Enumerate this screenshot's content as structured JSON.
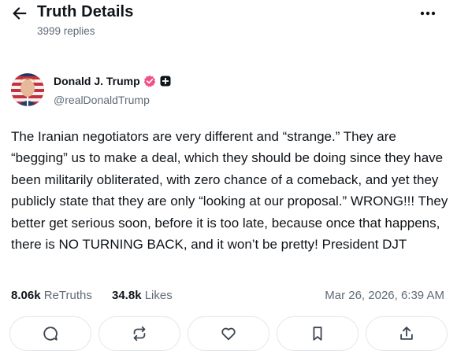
{
  "header": {
    "title": "Truth Details",
    "replies": "3999 replies",
    "back_icon": "arrow-left-icon",
    "more_icon": "more-horizontal-icon"
  },
  "author": {
    "name": "Donald J. Trump",
    "handle": "@realDonaldTrump",
    "verified_icon": "verified-badge-icon",
    "verified_color": "#f0508a",
    "plus_icon": "plus-badge-icon"
  },
  "post": {
    "text": "The Iranian negotiators are very different and “strange.” They are “begging” us to make a deal, which they should be doing since they have been militarily obliterated, with zero chance of a comeback, and yet they publicly state that they are only “looking at our proposal.” WRONG!!! They better get serious soon, before it is too late, because once that happens, there is NO TURNING BACK, and it won’t be pretty! President DJT"
  },
  "stats": {
    "retruths_count": "8.06k",
    "retruths_label": "ReTruths",
    "likes_count": "34.8k",
    "likes_label": "Likes",
    "timestamp": "Mar 26, 2026, 6:39 AM"
  },
  "actions": [
    {
      "icon": "reply-icon"
    },
    {
      "icon": "retruth-icon"
    },
    {
      "icon": "heart-icon"
    },
    {
      "icon": "bookmark-icon"
    },
    {
      "icon": "share-icon"
    }
  ],
  "colors": {
    "text_primary": "#0f1419",
    "text_secondary": "#5f6b78",
    "border": "#e3e6ea"
  }
}
